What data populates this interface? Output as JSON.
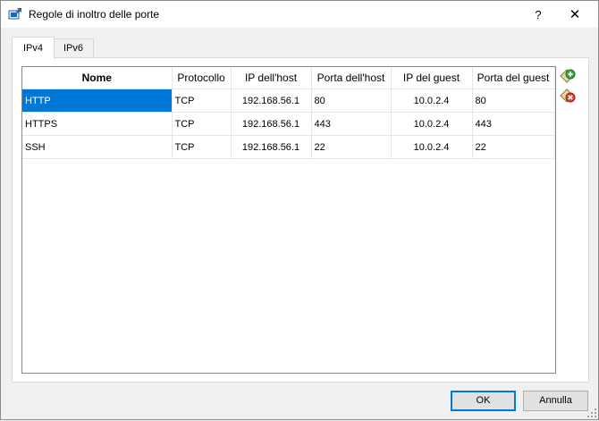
{
  "window": {
    "title": "Regole di inoltro delle porte",
    "help_label": "?",
    "close_label": "✕"
  },
  "tabs": [
    {
      "label": "IPv4",
      "active": true
    },
    {
      "label": "IPv6",
      "active": false
    }
  ],
  "table": {
    "columns": [
      "Nome",
      "Protocollo",
      "IP dell'host",
      "Porta dell'host",
      "IP del guest",
      "Porta del guest"
    ],
    "rows": [
      {
        "name": "HTTP",
        "protocol": "TCP",
        "host_ip": "192.168.56.1",
        "host_port": "80",
        "guest_ip": "10.0.2.4",
        "guest_port": "80",
        "selected": true
      },
      {
        "name": "HTTPS",
        "protocol": "TCP",
        "host_ip": "192.168.56.1",
        "host_port": "443",
        "guest_ip": "10.0.2.4",
        "guest_port": "443",
        "selected": false
      },
      {
        "name": "SSH",
        "protocol": "TCP",
        "host_ip": "192.168.56.1",
        "host_port": "22",
        "guest_ip": "10.0.2.4",
        "guest_port": "22",
        "selected": false
      }
    ]
  },
  "side_actions": [
    {
      "icon": "add-rule-icon"
    },
    {
      "icon": "remove-rule-icon"
    }
  ],
  "buttons": {
    "ok_label": "OK",
    "cancel_label": "Annulla"
  },
  "colors": {
    "selection": "#0078d7",
    "add_green": "#3aa83a",
    "remove_red": "#d9442c"
  }
}
